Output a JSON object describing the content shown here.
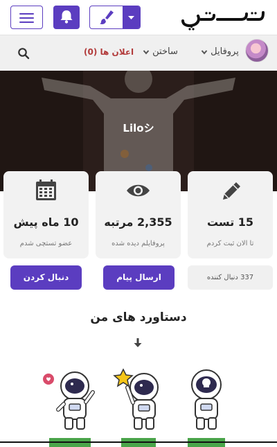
{
  "header": {
    "logo_text": "تستچی",
    "menu_icon": "hamburger-icon",
    "bell_icon": "bell-icon",
    "brush_icon": "paintbrush-icon",
    "accent_color": "#5b3dc0"
  },
  "nav": {
    "ads_label": "اعلان ها (0)",
    "build_label": "ساختن",
    "profile_label": "پروفایل",
    "search_icon": "search-icon"
  },
  "profile": {
    "username": "Liloシ"
  },
  "stats": [
    {
      "icon": "calendar-icon",
      "value": "10 ماه پیش",
      "caption": "عضو تستچی شدم"
    },
    {
      "icon": "eye-icon",
      "value": "2,355 مرتبه",
      "caption": "پروفایلم دیده شده"
    },
    {
      "icon": "pencil-icon",
      "value": "15 تست",
      "caption": "تا الان ثبت کردم"
    }
  ],
  "actions": {
    "follow_label": "دنبال کردن",
    "message_label": "ارسال پیام",
    "followers_text": "337 دنبال کننده"
  },
  "achievements": {
    "title": "دستاورد های من"
  }
}
